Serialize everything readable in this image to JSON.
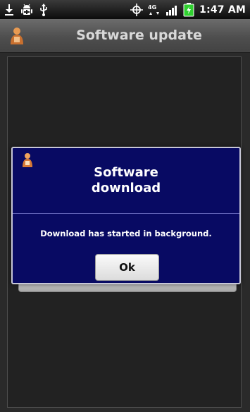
{
  "status_bar": {
    "time": "1:47 AM",
    "network_label": "4G",
    "icons": [
      "download-icon",
      "android-debug-icon",
      "usb-icon",
      "gps-icon",
      "network-4g-icon",
      "signal-bars-icon",
      "battery-icon"
    ]
  },
  "header": {
    "title": "Software update",
    "app_icon": "app-icon"
  },
  "dialog": {
    "icon": "alert-app-icon",
    "title": "Software\ndownload",
    "message": "Download has started in background.",
    "ok_label": "Ok"
  },
  "colors": {
    "dialog_background": "#080a63",
    "title_bar": "#4e4e4e",
    "content_background": "#222222",
    "battery": "#2fd12f",
    "button_face": "#f0f0f0"
  }
}
